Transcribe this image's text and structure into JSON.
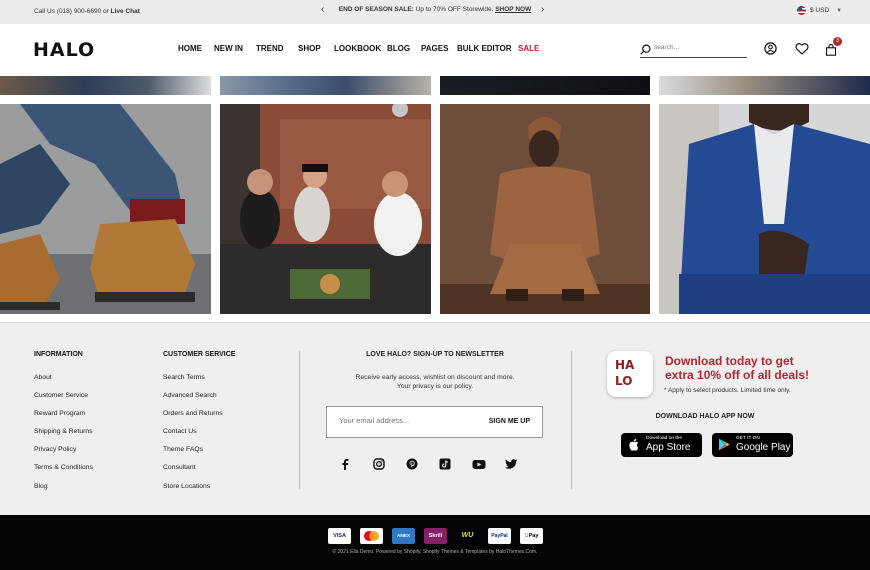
{
  "topbar": {
    "contact_prefix": "Call Us (018) 900-6690 or",
    "contact_link": "Live Chat",
    "promo_bold": "END OF SEASON SALE:",
    "promo_text": "Up to 70% OFF Storewide.",
    "promo_link": "SHOP NOW",
    "prev_icon": "chevron-left-icon",
    "next_icon": "chevron-right-icon",
    "currency": "$ USD"
  },
  "header": {
    "logo": "HALO",
    "nav": [
      "HOME",
      "NEW IN",
      "TREND",
      "SHOP",
      "LOOKBOOK",
      "BLOG",
      "PAGES",
      "BULK EDITOR",
      "SALE"
    ],
    "sale_color": "#b3262f",
    "search_placeholder": "search...",
    "cart_count": "3"
  },
  "gallery": {
    "images": [
      "boots-photo",
      "friends-photo",
      "sweater-photo",
      "blazer-photo"
    ]
  },
  "footer": {
    "information": {
      "title": "INFORMATION",
      "links": [
        "About",
        "Customer Service",
        "Reward Program",
        "Shipping & Returns",
        "Privacy Policy",
        "Terms & Conditions",
        "Blog"
      ]
    },
    "customer_service": {
      "title": "CUSTOMER SERVICE",
      "links": [
        "Search Terms",
        "Advanced Search",
        "Orders and Returns",
        "Contact Us",
        "Theme FAQs",
        "Consultant",
        "Store Locations"
      ]
    },
    "newsletter": {
      "title": "LOVE HALO? SIGN-UP TO NEWSLETTER",
      "text_line1": "Receive early access, wishlist on discount and more.",
      "text_line2": "Your privacy is our policy.",
      "placeholder": "Your email address...",
      "button": "SIGN ME UP",
      "socials": [
        "facebook-icon",
        "instagram-icon",
        "pinterest-icon",
        "tiktok-icon",
        "youtube-icon",
        "twitter-icon"
      ]
    },
    "app": {
      "logo_top": "HA",
      "logo_bottom": "LO",
      "headline_line1": "Download today to get",
      "headline_line2": "extra 10% off of all deals!",
      "note": "* Apply to select products. Limited time only.",
      "download_title": "DOWNLOAD HALO APP NOW",
      "appstore_small": "Download on the",
      "appstore_big": "App Store",
      "googleplay_small": "GET IT ON",
      "googleplay_big": "Google Play"
    }
  },
  "bottom": {
    "payments": [
      "VISA",
      "MC",
      "AMEX",
      "Skrill",
      "WU",
      "PayPal",
      "Pay"
    ],
    "copyright": "© 2021 Ella Demo. Powered by Shopify. Shopify Themes & Templates by HaloThemes.Com."
  }
}
